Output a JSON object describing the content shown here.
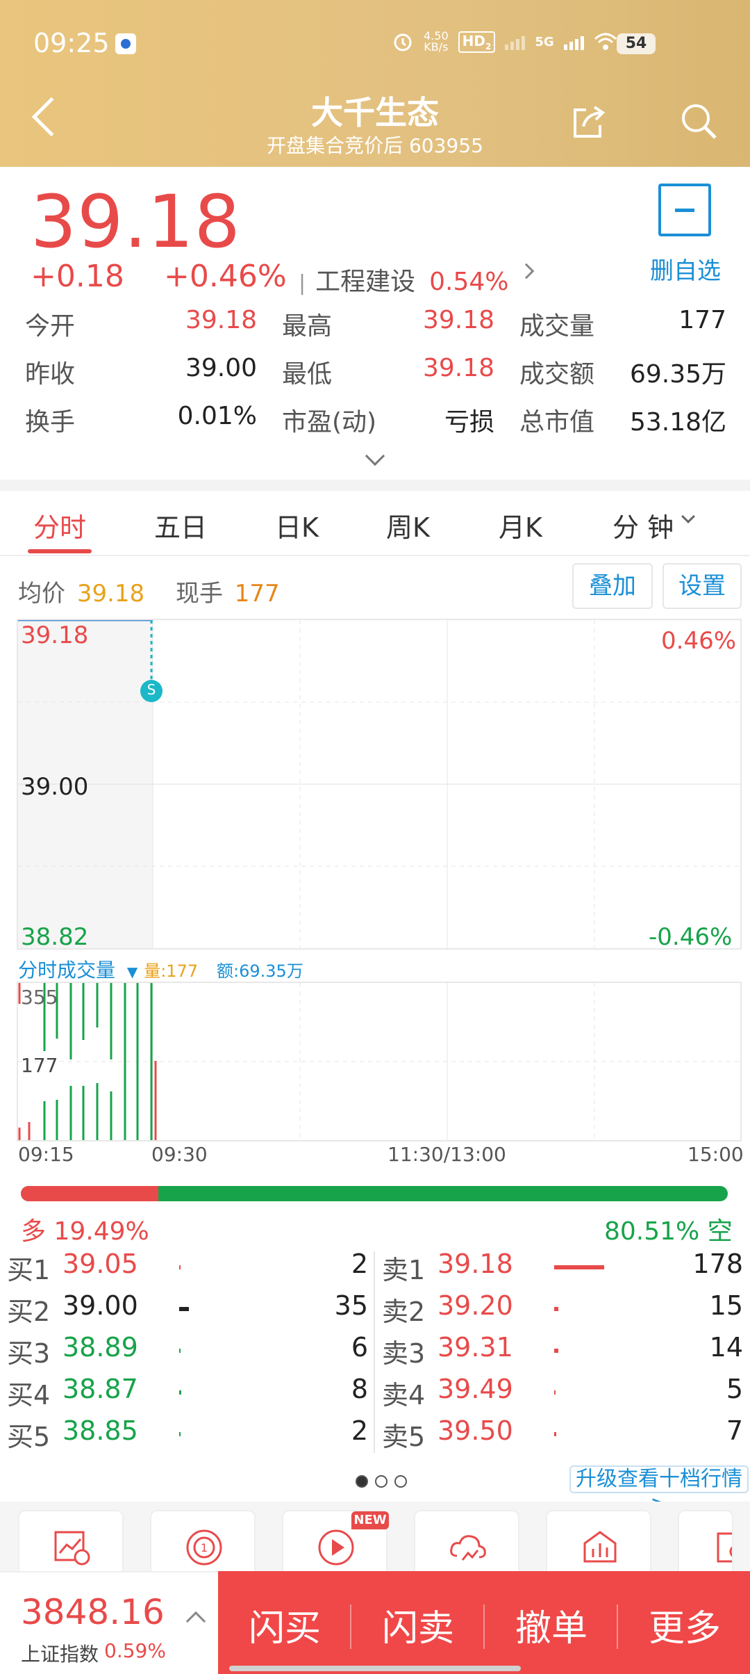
{
  "status_bar": {
    "time": "09:25",
    "net_speed_value": "4.50",
    "net_speed_unit": "KB/s",
    "hd": "HD",
    "hd_sub": "2",
    "net": "5G",
    "battery": "54"
  },
  "header": {
    "title": "大千生态",
    "subtitle": "开盘集合竞价后 603955"
  },
  "quote": {
    "price": "39.18",
    "change": "+0.18",
    "change_pct": "+0.46%",
    "sector_sep": "|",
    "sector_name": "工程建设",
    "sector_pct": "0.54%",
    "watch_label": "删自选"
  },
  "stats": [
    [
      {
        "label": "今开",
        "value": "39.18",
        "color": "red"
      },
      {
        "label": "最高",
        "value": "39.18",
        "color": "red"
      },
      {
        "label": "成交量",
        "value": "177",
        "color": "dark"
      }
    ],
    [
      {
        "label": "昨收",
        "value": "39.00",
        "color": "dark"
      },
      {
        "label": "最低",
        "value": "39.18",
        "color": "red"
      },
      {
        "label": "成交额",
        "value": "69.35万",
        "color": "dark"
      }
    ],
    [
      {
        "label": "换手",
        "value": "0.01%",
        "color": "dark"
      },
      {
        "label": "市盈(动)",
        "value": "亏损",
        "color": "dark"
      },
      {
        "label": "总市值",
        "value": "53.18亿",
        "color": "dark"
      }
    ]
  ],
  "tabs": [
    "分时",
    "五日",
    "日K",
    "周K",
    "月K",
    "分 钟"
  ],
  "intraday": {
    "avg_label": "均价",
    "avg_value": "39.18",
    "hand_label": "现手",
    "hand_value": "177",
    "overlay_btn": "叠加",
    "settings_btn": "设置",
    "y_high": "39.18",
    "y_mid": "39.00",
    "y_low": "38.82",
    "pct_high": "0.46%",
    "pct_low": "-0.46%",
    "marker": "S",
    "vol_title": "分时成交量",
    "vol_qty": "量:177",
    "vol_amt": "额:69.35万",
    "vol_high": "355",
    "vol_mid": "177",
    "times": [
      "09:15",
      "09:30",
      "11:30/13:00",
      "15:00"
    ]
  },
  "ratio": {
    "buy_label": "多",
    "buy_pct": "19.49%",
    "sell_pct": "80.51%",
    "sell_label": "空",
    "buy_fraction": 0.1949
  },
  "order_book": {
    "bids": [
      {
        "label": "买1",
        "price": "39.05",
        "qty": "2",
        "color": "red"
      },
      {
        "label": "买2",
        "price": "39.00",
        "qty": "35",
        "color": "dark"
      },
      {
        "label": "买3",
        "price": "38.89",
        "qty": "6",
        "color": "green"
      },
      {
        "label": "买4",
        "price": "38.87",
        "qty": "8",
        "color": "green"
      },
      {
        "label": "买5",
        "price": "38.85",
        "qty": "2",
        "color": "green"
      }
    ],
    "asks": [
      {
        "label": "卖1",
        "price": "39.18",
        "qty": "178",
        "color": "red"
      },
      {
        "label": "卖2",
        "price": "39.20",
        "qty": "15",
        "color": "red"
      },
      {
        "label": "卖3",
        "price": "39.31",
        "qty": "14",
        "color": "red"
      },
      {
        "label": "卖4",
        "price": "39.49",
        "qty": "5",
        "color": "red"
      },
      {
        "label": "卖5",
        "price": "39.50",
        "qty": "7",
        "color": "red"
      }
    ],
    "upgrade_link": "升级查看十档行情>"
  },
  "shortcuts": {
    "new_badge": "NEW"
  },
  "bottom": {
    "index_value": "3848.16",
    "index_name": "上证指数",
    "index_pct": "0.59%",
    "actions": [
      "闪买",
      "闪卖",
      "撤单",
      "更多"
    ]
  }
}
